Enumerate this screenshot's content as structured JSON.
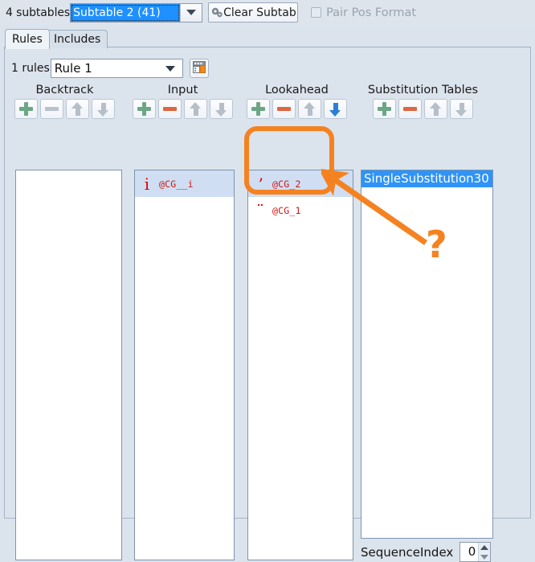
{
  "topbar": {
    "subtables_label": "4 subtables",
    "subtable_combo": {
      "value": "Subtable 2 (41)",
      "icon": "chevron-down-icon"
    },
    "clear_button": {
      "label": "Clear Subtable",
      "icon": "gears-icon"
    },
    "pair_pos_format": {
      "label": "Pair Pos Format",
      "checked": false,
      "enabled": false
    }
  },
  "tabs": [
    {
      "label": "Rules",
      "active": true
    },
    {
      "label": "Includes",
      "active": false
    }
  ],
  "rules_bar": {
    "count_label": "1 rules",
    "rule_combo": {
      "value": "Rule 1",
      "icon": "chevron-down-icon"
    },
    "grid_button_icon": "table-grid-icon"
  },
  "columns": [
    {
      "title": "Backtrack",
      "buttons": [
        {
          "name": "add-button",
          "icon": "plus-icon",
          "enabled": true
        },
        {
          "name": "remove-button",
          "icon": "minus-icon",
          "enabled": false
        },
        {
          "name": "move-up-button",
          "icon": "arrow-up-icon",
          "enabled": false
        },
        {
          "name": "move-down-button",
          "icon": "arrow-down-icon",
          "enabled": false
        }
      ],
      "items": []
    },
    {
      "title": "Input",
      "buttons": [
        {
          "name": "add-button",
          "icon": "plus-icon",
          "enabled": true
        },
        {
          "name": "remove-button",
          "icon": "minus-icon",
          "enabled": true
        },
        {
          "name": "move-up-button",
          "icon": "arrow-up-icon",
          "enabled": false
        },
        {
          "name": "move-down-button",
          "icon": "arrow-down-icon",
          "enabled": false
        }
      ],
      "items": [
        {
          "glyph": "i",
          "name": "@CG__i",
          "selected": true
        }
      ]
    },
    {
      "title": "Lookahead",
      "buttons": [
        {
          "name": "add-button",
          "icon": "plus-icon",
          "enabled": true
        },
        {
          "name": "remove-button",
          "icon": "minus-icon",
          "enabled": true
        },
        {
          "name": "move-up-button",
          "icon": "arrow-up-icon",
          "enabled": false
        },
        {
          "name": "move-down-button",
          "icon": "arrow-down-icon",
          "enabled": true
        }
      ],
      "items": [
        {
          "glyph": "ʼ",
          "name": "@CG_2",
          "selected": true
        },
        {
          "glyph": "¨",
          "name": "@CG_1",
          "selected": false
        }
      ]
    },
    {
      "title": "Substitution Tables",
      "buttons": [
        {
          "name": "add-button",
          "icon": "plus-icon",
          "enabled": true
        },
        {
          "name": "remove-button",
          "icon": "minus-icon",
          "enabled": true
        },
        {
          "name": "move-up-button",
          "icon": "arrow-up-icon",
          "enabled": false
        },
        {
          "name": "move-down-button",
          "icon": "arrow-down-icon",
          "enabled": false
        }
      ],
      "items": [
        {
          "name": "SingleSubstitution30",
          "selected": true
        }
      ]
    }
  ],
  "sequence_index": {
    "label": "SequenceIndex",
    "value": "0"
  },
  "annotation": {
    "color": "#f58220",
    "question_mark": "?",
    "highlight_target": "lookahead-list",
    "arrow": "points-to-lookahead-list"
  }
}
